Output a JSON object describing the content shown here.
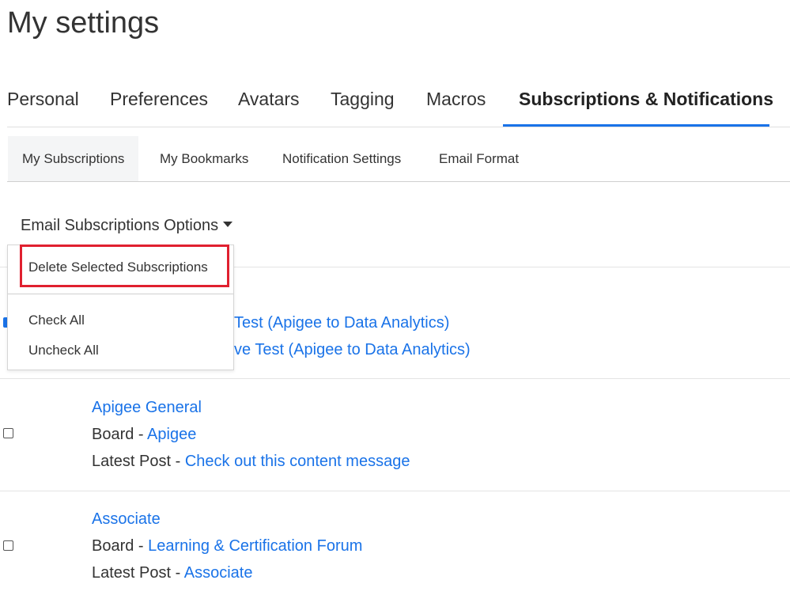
{
  "page": {
    "title": "My settings"
  },
  "primary_tabs": [
    {
      "label": "Personal"
    },
    {
      "label": "Preferences"
    },
    {
      "label": "Avatars"
    },
    {
      "label": "Tagging"
    },
    {
      "label": "Macros"
    },
    {
      "label": "Subscriptions & Notifications",
      "active": true
    }
  ],
  "secondary_tabs": [
    {
      "label": "My Subscriptions",
      "active": true
    },
    {
      "label": "My Bookmarks"
    },
    {
      "label": "Notification Settings"
    },
    {
      "label": "Email Format"
    }
  ],
  "options_menu": {
    "label": "Email Subscriptions Options",
    "items": [
      {
        "label": "Delete Selected Subscriptions",
        "highlighted": true
      },
      {
        "label": "Check All"
      },
      {
        "label": "Uncheck All"
      }
    ]
  },
  "subscriptions": [
    {
      "checked": true,
      "partial_title": "Test (Apigee to Data Analytics)",
      "partial_board": "ve Test (Apigee to Data Analytics)"
    },
    {
      "checked": false,
      "title": "Apigee General",
      "board_prefix": "Board - ",
      "board": "Apigee",
      "post_prefix": "Latest Post - ",
      "latest_post": "Check out this content message"
    },
    {
      "checked": false,
      "title": "Associate",
      "board_prefix": "Board - ",
      "board": "Learning & Certification Forum",
      "post_prefix": "Latest Post - ",
      "latest_post": "Associate"
    }
  ],
  "colors": {
    "link": "#1a73e8",
    "active_tab_underline": "#1a73e8",
    "highlight_box": "#e0202f"
  }
}
